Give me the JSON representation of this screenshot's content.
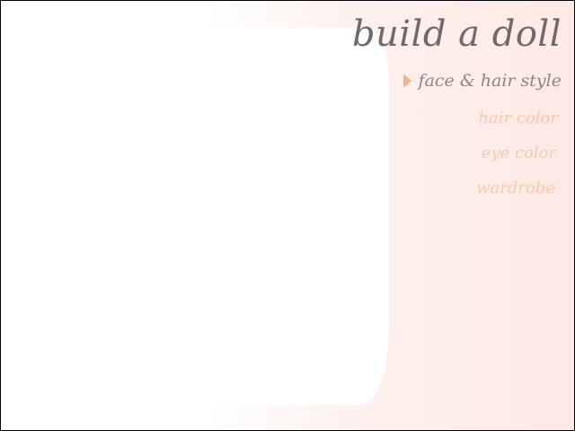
{
  "app": {
    "title": "build a doll"
  },
  "menu": {
    "items": [
      {
        "label": "face & hair style",
        "active": true
      },
      {
        "label": "hair color",
        "active": false
      },
      {
        "label": "eye color",
        "active": false
      },
      {
        "label": "wardrobe",
        "active": false
      }
    ]
  },
  "colors": {
    "active_arrow": "#f2b48f",
    "active_text": "#8c8683",
    "inactive_text": "#f5c9ad",
    "title_text": "#6f6a68",
    "background_tint": "#fde9e5"
  },
  "icons": {
    "active_marker": "play-triangle-icon"
  }
}
